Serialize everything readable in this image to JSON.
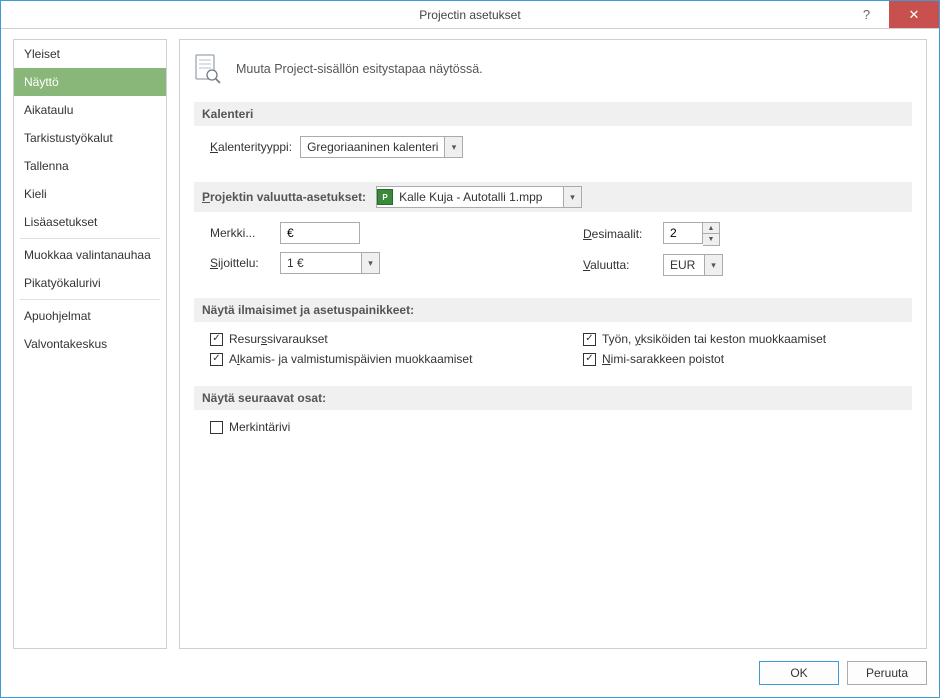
{
  "window": {
    "title": "Projectin asetukset"
  },
  "sidebar": {
    "items": [
      {
        "label": "Yleiset"
      },
      {
        "label": "Näyttö"
      },
      {
        "label": "Aikataulu"
      },
      {
        "label": "Tarkistustyökalut"
      },
      {
        "label": "Tallenna"
      },
      {
        "label": "Kieli"
      },
      {
        "label": "Lisäasetukset"
      },
      {
        "label": "Muokkaa valintanauhaa"
      },
      {
        "label": "Pikatyökalurivi"
      },
      {
        "label": "Apuohjelmat"
      },
      {
        "label": "Valvontakeskus"
      }
    ],
    "selected_index": 1
  },
  "header": {
    "text": "Muuta Project-sisällön esitystapaa näytössä."
  },
  "calendar": {
    "section_title": "Kalenteri",
    "type_label_pre": "K",
    "type_label_post": "alenterityyppi:",
    "type_value": "Gregoriaaninen kalenteri"
  },
  "currency": {
    "section_pre": "P",
    "section_post": "rojektin valuutta-asetukset:",
    "project_value": "Kalle Kuja - Autotalli 1.mpp",
    "symbol_label": "Merkki...",
    "symbol_value": "€",
    "placement_label_pre": "S",
    "placement_label_post": "ijoittelu:",
    "placement_value": "1 €",
    "decimals_label_pre": "D",
    "decimals_label_post": "esimaalit:",
    "decimals_value": "2",
    "currency_label_pre": "V",
    "currency_label_post": "aluutta:",
    "currency_value": "EUR"
  },
  "indicators": {
    "section_title": "Näytä ilmaisimet ja asetuspainikkeet:",
    "resource_pre": "Resur",
    "resource_u": "s",
    "resource_post": "sivaraukset",
    "startend_pre": "A",
    "startend_u": "l",
    "startend_post": "kamis- ja valmistumispäivien muokkaamiset",
    "work_pre": "Työn, ",
    "work_u": "y",
    "work_post": "ksiköiden tai keston muokkaamiset",
    "namecol_pre": "",
    "namecol_u": "N",
    "namecol_post": "imi-sarakkeen poistot"
  },
  "show_parts": {
    "section_title": "Näytä seuraavat osat:",
    "entry_bar": "Merkintärivi"
  },
  "buttons": {
    "ok": "OK",
    "cancel": "Peruuta"
  }
}
